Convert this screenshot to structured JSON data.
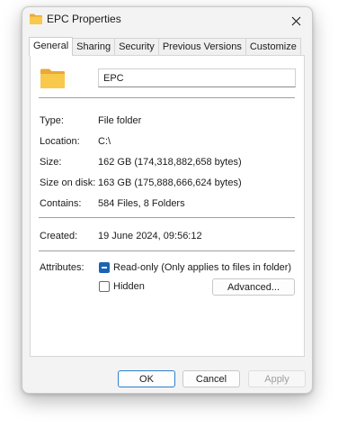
{
  "window": {
    "title": "EPC Properties"
  },
  "tabs": [
    "General",
    "Sharing",
    "Security",
    "Previous Versions",
    "Customize"
  ],
  "general": {
    "name_value": "EPC",
    "rows": [
      {
        "label": "Type:",
        "value": "File folder"
      },
      {
        "label": "Location:",
        "value": "C:\\"
      },
      {
        "label": "Size:",
        "value": "162 GB (174,318,882,658 bytes)"
      },
      {
        "label": "Size on disk:",
        "value": "163 GB (175,888,666,624 bytes)"
      },
      {
        "label": "Contains:",
        "value": "584 Files, 8 Folders"
      },
      {
        "label": "Created:",
        "value": "19 June 2024, 09:56:12"
      }
    ],
    "attributes_label": "Attributes:",
    "readonly_label": "Read-only (Only applies to files in folder)",
    "readonly_state": "indeterminate",
    "hidden_label": "Hidden",
    "hidden_checked": false,
    "advanced_label": "Advanced..."
  },
  "buttons": {
    "ok": "OK",
    "cancel": "Cancel",
    "apply": "Apply"
  },
  "colors": {
    "accent": "#1a64b4",
    "folder": "#f8c94a"
  },
  "icons": {
    "title": "folder-icon",
    "close": "close-icon",
    "big": "folder-icon"
  }
}
